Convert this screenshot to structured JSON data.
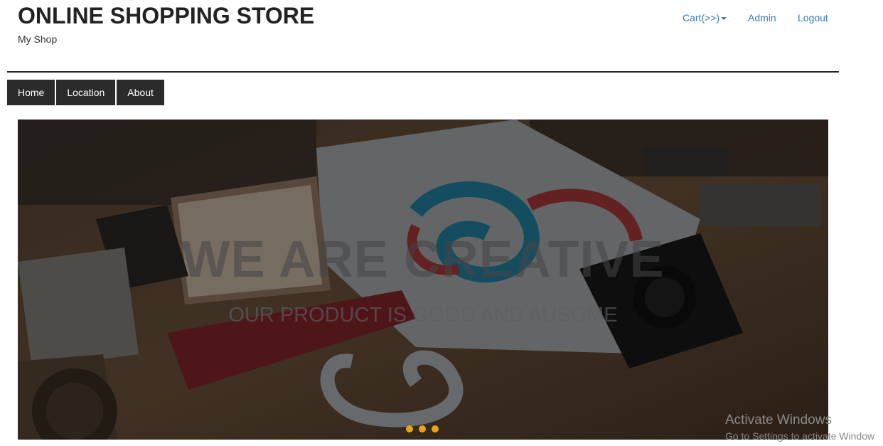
{
  "header": {
    "title_bold": "ONLINE",
    "title_rest": " SHOPPING STORE",
    "subtitle": "My Shop"
  },
  "topnav": {
    "cart": "Cart(>>)",
    "admin": "Admin",
    "logout": "Logout"
  },
  "menu": [
    "Home",
    "Location",
    "About"
  ],
  "hero": {
    "headline": "WE ARE CREATIVE",
    "subline": "OUR PRODUCT IS GOOD AND AUSOME",
    "slide_count": 3
  },
  "watermark": {
    "line1": "Activate Windows",
    "line2": "Go to Settings to activate Window"
  },
  "colors": {
    "link": "#337ab7",
    "menu_bg": "#2b2b2b",
    "dot": "#e8a317"
  }
}
